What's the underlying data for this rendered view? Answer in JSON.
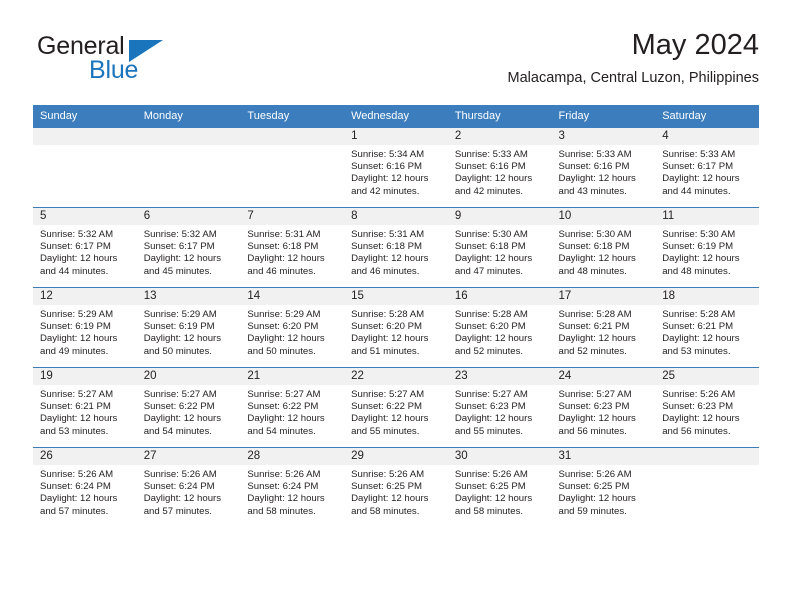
{
  "brand": {
    "name_part1": "General",
    "name_part2": "Blue",
    "triangle_color": "#1b75bc",
    "text_color": "#231f20"
  },
  "header": {
    "title": "May 2024",
    "subtitle": "Malacampa, Central Luzon, Philippines"
  },
  "theme": {
    "header_bg": "#3b7dbd",
    "header_text": "#ffffff",
    "daynum_bg": "#f1f1f1",
    "cell_bg": "#ffffff",
    "border": "#3b7dbd",
    "body_text": "#231f20"
  },
  "weekdays": [
    "Sunday",
    "Monday",
    "Tuesday",
    "Wednesday",
    "Thursday",
    "Friday",
    "Saturday"
  ],
  "weeks": [
    [
      {
        "day": "",
        "empty": true
      },
      {
        "day": "",
        "empty": true
      },
      {
        "day": "",
        "empty": true
      },
      {
        "day": "1",
        "sunrise": "Sunrise: 5:34 AM",
        "sunset": "Sunset: 6:16 PM",
        "daylight1": "Daylight: 12 hours",
        "daylight2": "and 42 minutes."
      },
      {
        "day": "2",
        "sunrise": "Sunrise: 5:33 AM",
        "sunset": "Sunset: 6:16 PM",
        "daylight1": "Daylight: 12 hours",
        "daylight2": "and 42 minutes."
      },
      {
        "day": "3",
        "sunrise": "Sunrise: 5:33 AM",
        "sunset": "Sunset: 6:16 PM",
        "daylight1": "Daylight: 12 hours",
        "daylight2": "and 43 minutes."
      },
      {
        "day": "4",
        "sunrise": "Sunrise: 5:33 AM",
        "sunset": "Sunset: 6:17 PM",
        "daylight1": "Daylight: 12 hours",
        "daylight2": "and 44 minutes."
      }
    ],
    [
      {
        "day": "5",
        "sunrise": "Sunrise: 5:32 AM",
        "sunset": "Sunset: 6:17 PM",
        "daylight1": "Daylight: 12 hours",
        "daylight2": "and 44 minutes."
      },
      {
        "day": "6",
        "sunrise": "Sunrise: 5:32 AM",
        "sunset": "Sunset: 6:17 PM",
        "daylight1": "Daylight: 12 hours",
        "daylight2": "and 45 minutes."
      },
      {
        "day": "7",
        "sunrise": "Sunrise: 5:31 AM",
        "sunset": "Sunset: 6:18 PM",
        "daylight1": "Daylight: 12 hours",
        "daylight2": "and 46 minutes."
      },
      {
        "day": "8",
        "sunrise": "Sunrise: 5:31 AM",
        "sunset": "Sunset: 6:18 PM",
        "daylight1": "Daylight: 12 hours",
        "daylight2": "and 46 minutes."
      },
      {
        "day": "9",
        "sunrise": "Sunrise: 5:30 AM",
        "sunset": "Sunset: 6:18 PM",
        "daylight1": "Daylight: 12 hours",
        "daylight2": "and 47 minutes."
      },
      {
        "day": "10",
        "sunrise": "Sunrise: 5:30 AM",
        "sunset": "Sunset: 6:18 PM",
        "daylight1": "Daylight: 12 hours",
        "daylight2": "and 48 minutes."
      },
      {
        "day": "11",
        "sunrise": "Sunrise: 5:30 AM",
        "sunset": "Sunset: 6:19 PM",
        "daylight1": "Daylight: 12 hours",
        "daylight2": "and 48 minutes."
      }
    ],
    [
      {
        "day": "12",
        "sunrise": "Sunrise: 5:29 AM",
        "sunset": "Sunset: 6:19 PM",
        "daylight1": "Daylight: 12 hours",
        "daylight2": "and 49 minutes."
      },
      {
        "day": "13",
        "sunrise": "Sunrise: 5:29 AM",
        "sunset": "Sunset: 6:19 PM",
        "daylight1": "Daylight: 12 hours",
        "daylight2": "and 50 minutes."
      },
      {
        "day": "14",
        "sunrise": "Sunrise: 5:29 AM",
        "sunset": "Sunset: 6:20 PM",
        "daylight1": "Daylight: 12 hours",
        "daylight2": "and 50 minutes."
      },
      {
        "day": "15",
        "sunrise": "Sunrise: 5:28 AM",
        "sunset": "Sunset: 6:20 PM",
        "daylight1": "Daylight: 12 hours",
        "daylight2": "and 51 minutes."
      },
      {
        "day": "16",
        "sunrise": "Sunrise: 5:28 AM",
        "sunset": "Sunset: 6:20 PM",
        "daylight1": "Daylight: 12 hours",
        "daylight2": "and 52 minutes."
      },
      {
        "day": "17",
        "sunrise": "Sunrise: 5:28 AM",
        "sunset": "Sunset: 6:21 PM",
        "daylight1": "Daylight: 12 hours",
        "daylight2": "and 52 minutes."
      },
      {
        "day": "18",
        "sunrise": "Sunrise: 5:28 AM",
        "sunset": "Sunset: 6:21 PM",
        "daylight1": "Daylight: 12 hours",
        "daylight2": "and 53 minutes."
      }
    ],
    [
      {
        "day": "19",
        "sunrise": "Sunrise: 5:27 AM",
        "sunset": "Sunset: 6:21 PM",
        "daylight1": "Daylight: 12 hours",
        "daylight2": "and 53 minutes."
      },
      {
        "day": "20",
        "sunrise": "Sunrise: 5:27 AM",
        "sunset": "Sunset: 6:22 PM",
        "daylight1": "Daylight: 12 hours",
        "daylight2": "and 54 minutes."
      },
      {
        "day": "21",
        "sunrise": "Sunrise: 5:27 AM",
        "sunset": "Sunset: 6:22 PM",
        "daylight1": "Daylight: 12 hours",
        "daylight2": "and 54 minutes."
      },
      {
        "day": "22",
        "sunrise": "Sunrise: 5:27 AM",
        "sunset": "Sunset: 6:22 PM",
        "daylight1": "Daylight: 12 hours",
        "daylight2": "and 55 minutes."
      },
      {
        "day": "23",
        "sunrise": "Sunrise: 5:27 AM",
        "sunset": "Sunset: 6:23 PM",
        "daylight1": "Daylight: 12 hours",
        "daylight2": "and 55 minutes."
      },
      {
        "day": "24",
        "sunrise": "Sunrise: 5:27 AM",
        "sunset": "Sunset: 6:23 PM",
        "daylight1": "Daylight: 12 hours",
        "daylight2": "and 56 minutes."
      },
      {
        "day": "25",
        "sunrise": "Sunrise: 5:26 AM",
        "sunset": "Sunset: 6:23 PM",
        "daylight1": "Daylight: 12 hours",
        "daylight2": "and 56 minutes."
      }
    ],
    [
      {
        "day": "26",
        "sunrise": "Sunrise: 5:26 AM",
        "sunset": "Sunset: 6:24 PM",
        "daylight1": "Daylight: 12 hours",
        "daylight2": "and 57 minutes."
      },
      {
        "day": "27",
        "sunrise": "Sunrise: 5:26 AM",
        "sunset": "Sunset: 6:24 PM",
        "daylight1": "Daylight: 12 hours",
        "daylight2": "and 57 minutes."
      },
      {
        "day": "28",
        "sunrise": "Sunrise: 5:26 AM",
        "sunset": "Sunset: 6:24 PM",
        "daylight1": "Daylight: 12 hours",
        "daylight2": "and 58 minutes."
      },
      {
        "day": "29",
        "sunrise": "Sunrise: 5:26 AM",
        "sunset": "Sunset: 6:25 PM",
        "daylight1": "Daylight: 12 hours",
        "daylight2": "and 58 minutes."
      },
      {
        "day": "30",
        "sunrise": "Sunrise: 5:26 AM",
        "sunset": "Sunset: 6:25 PM",
        "daylight1": "Daylight: 12 hours",
        "daylight2": "and 58 minutes."
      },
      {
        "day": "31",
        "sunrise": "Sunrise: 5:26 AM",
        "sunset": "Sunset: 6:25 PM",
        "daylight1": "Daylight: 12 hours",
        "daylight2": "and 59 minutes."
      },
      {
        "day": "",
        "empty": true
      }
    ]
  ]
}
